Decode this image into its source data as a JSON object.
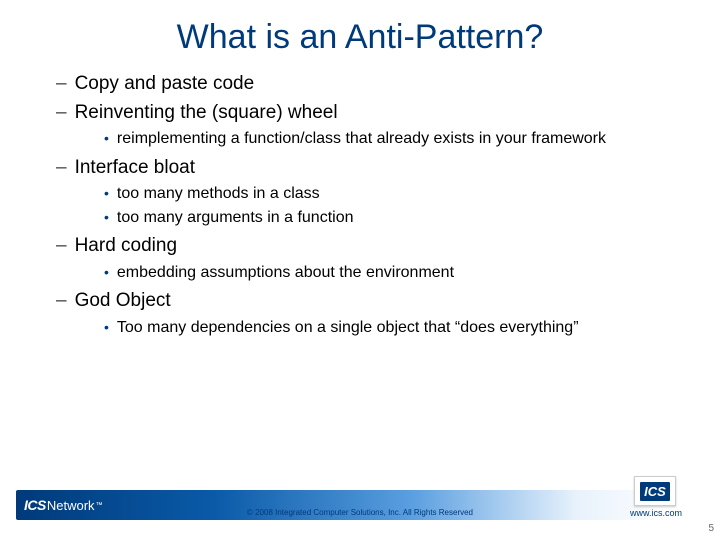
{
  "title": "What is an Anti-Pattern?",
  "items": [
    {
      "text": "Copy and paste code",
      "sub": []
    },
    {
      "text": "Reinventing the (square) wheel",
      "sub": [
        "reimplementing a function/class that already exists in your framework"
      ]
    },
    {
      "text": "Interface bloat",
      "sub": [
        "too many methods in a class",
        "too many arguments in a function"
      ]
    },
    {
      "text": "Hard coding",
      "sub": [
        "embedding assumptions about the environment"
      ]
    },
    {
      "text": "God Object",
      "sub": [
        "Too many dependencies on a single object that “does everything”"
      ]
    }
  ],
  "footer": {
    "logo_left_bold": "ICS",
    "logo_left_rest": "Network",
    "logo_left_tm": "™",
    "copyright": "© 2008 Integrated Computer Solutions, Inc. All Rights Reserved",
    "logo_right": "ICS",
    "url": "www.ics.com",
    "page": "5"
  }
}
